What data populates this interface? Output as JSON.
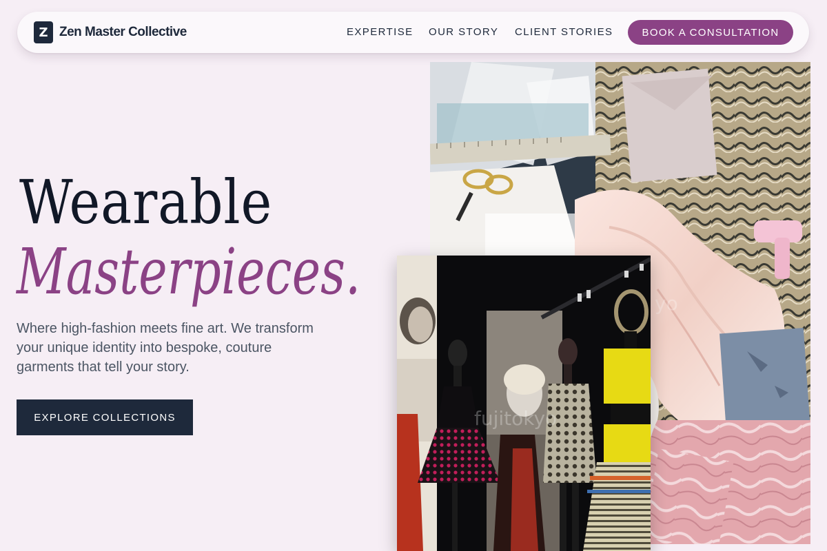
{
  "brand": {
    "mark": "Z",
    "name": "Zen Master Collective"
  },
  "nav": {
    "links": [
      "EXPERTISE",
      "OUR STORY",
      "CLIENT STORIES"
    ],
    "cta": "BOOK A CONSULTATION"
  },
  "hero": {
    "title_line1": "Wearable",
    "title_line2": "Masterpieces.",
    "subtitle": "Where high-fashion meets fine art. We transform your unique identity into bespoke, couture garments that tell your story.",
    "cta": "EXPLORE COLLECTIONS"
  },
  "images": {
    "back_watermark": "yo",
    "front_watermark": "fujitokyo"
  },
  "colors": {
    "background": "#f6eef5",
    "accent": "#8b4285",
    "dark": "#1e293b"
  }
}
